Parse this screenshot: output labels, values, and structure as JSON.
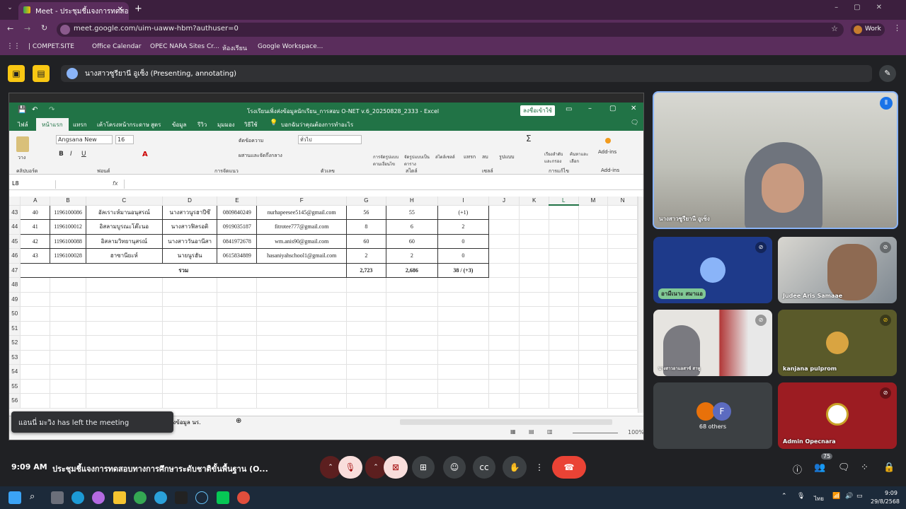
{
  "browser": {
    "tab_title": "Meet - ประชุมชี้แจงการทดสอบ",
    "url": "meet.google.com/uim-uaww-hbm?authuser=0",
    "profile_label": "Work",
    "bookmarks": [
      "| COMPET.SITE",
      "Office Calendar",
      "OPEC NARA Sites Cr...",
      "ห้องเรียน",
      "Google Workspace..."
    ]
  },
  "presenter_bar": {
    "text": "นางสาวซูรียานี อูเซ็ง (Presenting, annotating)"
  },
  "excel": {
    "title": "โรงเรียนเพิ่งส่งข้อมูลนักเรียน_การสอบ O-NET v.6_20250828_2333 - Excel",
    "signin": "ลงชื่อเข้าใช้",
    "menu": [
      "ไฟล์",
      "หน้าแรก",
      "แทรก",
      "เค้าโครงหน้ากระดาษ",
      "สูตร",
      "ข้อมูล",
      "รีวิว",
      "มุมมอง",
      "วิธีใช้",
      "บอกฉันว่าคุณต้องการทำอะไร"
    ],
    "ribbon": {
      "font_name": "Angsana New",
      "font_size": "16",
      "wrap_text": "ตัดข้อความ",
      "merge": "ผสานและจัดกึ่งกลาง",
      "number_format": "ทั่วไป",
      "groups": [
        "คลิปบอร์ด",
        "ฟอนต์",
        "การจัดแนว",
        "ตัวเลข",
        "สไตล์",
        "เซลล์",
        "การแก้ไข",
        "Add-ins"
      ],
      "styles_buttons": [
        "การจัดรูปแบบตามเงื่อนไข",
        "จัดรูปแบบเป็นตาราง",
        "สไตล์เซลล์"
      ],
      "cells_buttons": [
        "แทรก",
        "ลบ",
        "รูปแบบ"
      ],
      "edit_buttons": [
        "เรียงลำดับและกรอง",
        "ค้นหาและเลือก"
      ],
      "addins_label": "Add-ins",
      "paste_label": "วาง"
    },
    "name_box": "L8",
    "fx": "fx",
    "columns": [
      "A",
      "B",
      "C",
      "D",
      "E",
      "F",
      "G",
      "H",
      "I",
      "J",
      "K",
      "L",
      "M",
      "N"
    ],
    "rows": [
      {
        "n": "43",
        "cells": [
          "40",
          "1196100086",
          "อัลเราะห์มานอนุสรณ์",
          "นางสาวนูรฮาปีซ๊",
          "0809840249",
          "nurhapeesee5145@gmail.com",
          "56",
          "55",
          "(+1)"
        ]
      },
      {
        "n": "44",
        "cells": [
          "41",
          "1196100012",
          "อิสลามบูรณะโต๊ะนอ",
          "นางสาวฟิลรอติ",
          "0919035187",
          "fitrotee777@gmail.com",
          "8",
          "6",
          "2"
        ]
      },
      {
        "n": "45",
        "cells": [
          "42",
          "1196100088",
          "อิสลามวิทยานุสรณ์",
          "นางสาววันอานีสา",
          "0841972678",
          "wm.anis90@gmail.com",
          "60",
          "60",
          "0"
        ]
      },
      {
        "n": "46",
        "cells": [
          "43",
          "1196100028",
          "ฮาซานียะห์",
          "นายนูรฮัน",
          "0615834889",
          "hasaniyahschool1@gmail.com",
          "2",
          "2",
          "0"
        ]
      }
    ],
    "total_row": {
      "n": "47",
      "label": "รวม",
      "g": "2,723",
      "h": "2,686",
      "i": "38 / (+3)"
    },
    "empty_rows": [
      "48",
      "49",
      "50",
      "51",
      "52",
      "53",
      "54",
      "55",
      "56"
    ],
    "sheet_tab": "รายชื่อโรงเรียนที่ยังไม่ส่งข้อมูล นร.",
    "zoom": "100%"
  },
  "toast": "แอนนี่ มะวิง has left the meeting",
  "participants": {
    "main_speaker": "นางสาวซูรียานี อูเซ็ง",
    "tiles": [
      {
        "name": "อามีเนาะ สมาแอ",
        "initial": ""
      },
      {
        "name": "Judee Aris Samaae",
        "initial": ""
      },
      {
        "name": "นางสาวอาแอสาซ์ สาหู",
        "initial": ""
      },
      {
        "name": "kanjana pulprom",
        "initial": ""
      },
      {
        "name": "68 others",
        "initial": "F"
      },
      {
        "name": "Admin Opecnara",
        "initial": ""
      }
    ]
  },
  "footer": {
    "time": "9:09 AM",
    "meeting_title": "ประชุมชี้แจงการทดสอบทางการศึกษาระดับชาติขั้นพื้นฐาน (O...",
    "participant_count": "75"
  },
  "taskbar": {
    "lang": "ไทย",
    "clock_time": "9:09",
    "clock_date": "29/8/2568"
  },
  "colors": {
    "browser_purple": "#5a2d5c",
    "excel_green": "#217346",
    "meet_bg": "#202124",
    "end_call_red": "#ea4335",
    "accent_yellow": "#f9c713"
  }
}
